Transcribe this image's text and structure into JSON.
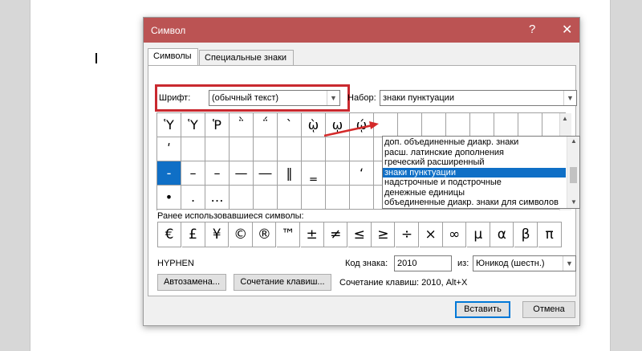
{
  "dialog": {
    "title": "Символ",
    "help_glyph": "?",
    "close_glyph": "✕",
    "tabs": [
      "Символы",
      "Специальные знаки"
    ],
    "font_label": "Шрифт:",
    "font_value": "(обычный текст)",
    "subset_label": "Набор:",
    "subset_value": "знаки пунктуации",
    "subset_options": [
      "доп. объединенные диакр. знаки",
      "расш. латинские дополнения",
      "греческий расширенный",
      "знаки пунктуации",
      "надстрочные и подстрочные",
      "денежные единицы",
      "объединенные диакр. знаки для символов"
    ],
    "symbols": [
      [
        "Ὑ",
        "Ὑ",
        "Ῥ",
        "῭",
        "΅",
        "`",
        "ῲ",
        "ῳ",
        "ῴ",
        "",
        "",
        "",
        "",
        "",
        "",
        "",
        ""
      ],
      [
        "ʹ",
        "",
        "",
        "",
        "",
        "",
        "",
        "",
        "",
        "",
        "",
        "",
        "",
        "",
        "",
        "",
        ""
      ],
      [
        "‐",
        "–",
        "–",
        "—",
        "―",
        "‖",
        "‗",
        "",
        "‘",
        "’",
        "",
        "",
        "",
        "",
        "",
        "",
        ""
      ],
      [
        "•",
        ".",
        "…",
        "",
        "",
        "",
        "",
        "",
        "",
        "",
        "‰",
        "′",
        "″",
        "‴",
        "‸",
        "‹",
        "›"
      ]
    ],
    "recent_label": "Ранее использовавшиеся символы:",
    "recent_symbols": [
      "€",
      "£",
      "¥",
      "©",
      "®",
      "™",
      "±",
      "≠",
      "≤",
      "≥",
      "÷",
      "×",
      "∞",
      "µ",
      "α",
      "β",
      "π"
    ],
    "char_name": "HYPHEN",
    "code_label": "Код знака:",
    "code_value": "2010",
    "from_label": "из:",
    "from_value": "Юникод (шестн.)",
    "autocorrect_button": "Автозамена...",
    "shortcut_button": "Сочетание клавиш...",
    "shortcut_text": "Сочетание клавиш: 2010, Alt+X",
    "insert_button": "Вставить",
    "cancel_button": "Отмена"
  },
  "colors": {
    "titlebar": "#bb5353",
    "selection": "#0f6fc6",
    "highlight_box": "#c9292f",
    "arrow": "#d42a2a"
  }
}
